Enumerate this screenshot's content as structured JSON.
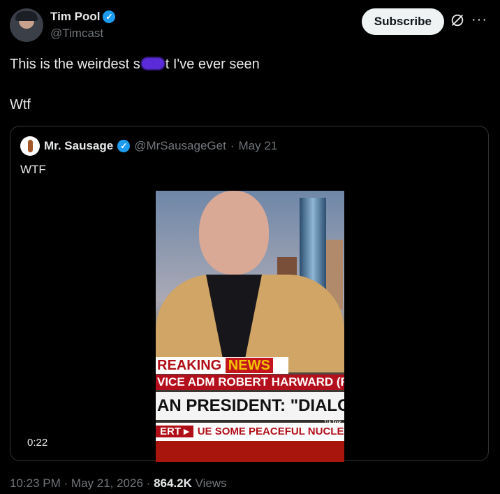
{
  "author": {
    "name": "Tim Pool",
    "handle": "@Timcast",
    "verified": true
  },
  "actions": {
    "subscribe_label": "Subscribe",
    "more_label": "···"
  },
  "tweet": {
    "text_before": "This is the weirdest s",
    "text_after": "t I've ever seen",
    "line2": "Wtf"
  },
  "quote": {
    "author_name": "Mr. Sausage",
    "author_handle": "@MrSausageGet",
    "separator": "·",
    "date": "May 21",
    "text": "WTF",
    "video": {
      "duration": "0:22",
      "chyron_breaking": "REAKING",
      "chyron_news": "NEWS",
      "chyron_line2": "VICE ADM ROBERT HARWARD (RI",
      "chyron_line3": "AN PRESIDENT: \"DIALOGUE DOES",
      "chyron_alert": "ERT ▸",
      "chyron_line4": "UE SOME PEACEFUL NUCLEAR",
      "watermark": "TikTok"
    }
  },
  "meta": {
    "time": "10:23 PM",
    "dot": "·",
    "date": "May 21, 2026",
    "views_count": "864.2K",
    "views_label": "Views"
  },
  "colors": {
    "accent": "#1d9bf0",
    "background": "#000000",
    "muted": "#71767b"
  }
}
